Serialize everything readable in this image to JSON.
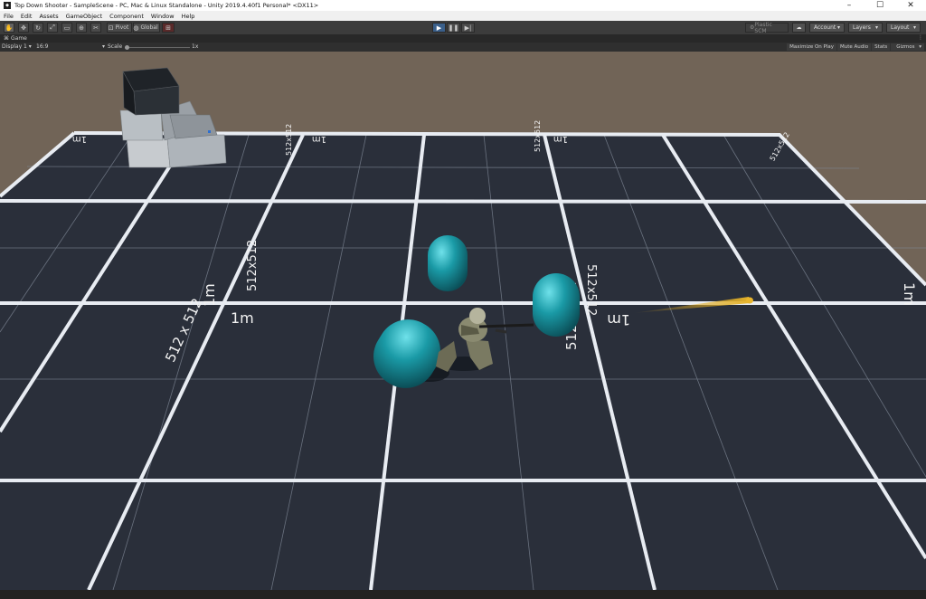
{
  "window": {
    "title": "Top Down Shooter - SampleScene - PC, Mac & Linux Standalone - Unity 2019.4.40f1 Personal* <DX11>",
    "minimize": "–",
    "maximize": "☐",
    "close": "✕"
  },
  "menu": [
    "File",
    "Edit",
    "Assets",
    "GameObject",
    "Component",
    "Window",
    "Help"
  ],
  "toolbar": {
    "pivot_label": "Pivot",
    "global_label": "Global",
    "plastic_label": "Plastic SCM",
    "account_label": "Account",
    "layers_label": "Layers",
    "layout_label": "Layout"
  },
  "game_tab": {
    "label": "Game"
  },
  "game_bar": {
    "display": "Display 1",
    "aspect": "16:9",
    "scale_label": "Scale",
    "scale_value": "1x",
    "maximize_on_play": "Maximize On Play",
    "mute_audio": "Mute Audio",
    "stats": "Stats",
    "gizmos": "Gizmos"
  },
  "scene": {
    "ground_labels": {
      "meter": "1m",
      "size": "512 x 512",
      "size_compact": "512x512"
    },
    "colors": {
      "sky": "#716457",
      "ground": "#2a2f3a",
      "grid_major": "#ffffff",
      "capsule": "#1a9aa6",
      "bullet": "#d9a21c"
    }
  }
}
